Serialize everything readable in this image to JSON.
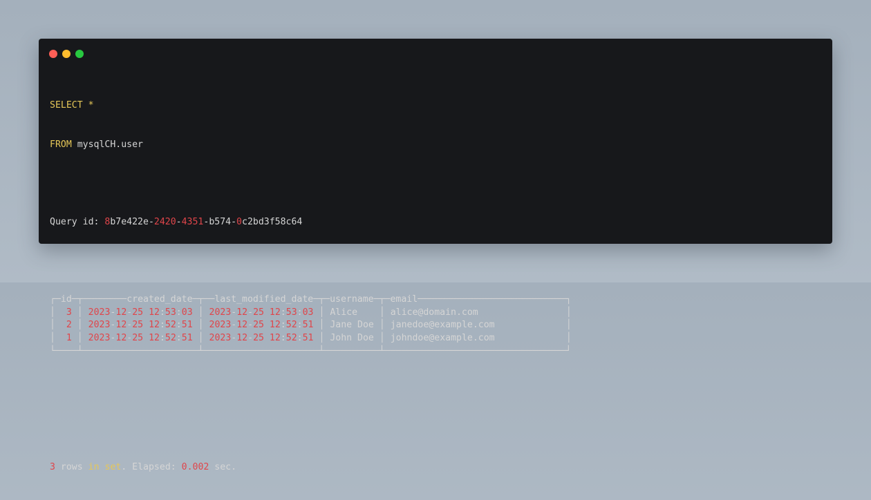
{
  "window": {
    "controls": [
      "close",
      "minimize",
      "maximize"
    ]
  },
  "query": {
    "select_keyword": "SELECT",
    "select_star": "*",
    "from_keyword": "FROM",
    "table": "mysqlCH.user"
  },
  "query_id": {
    "label": "Query id: ",
    "value": "8b7e422e-2420-4351-b574-0c2bd3f58c64"
  },
  "result": {
    "columns": [
      "id",
      "created_date",
      "last_modified_date",
      "username",
      "email"
    ],
    "rows": [
      [
        "3",
        "2023-12-25 12:53:03",
        "2023-12-25 12:53:03",
        "Alice",
        "alice@domain.com"
      ],
      [
        "2",
        "2023-12-25 12:52:51",
        "2023-12-25 12:52:51",
        "Jane Doe",
        "janedoe@example.com"
      ],
      [
        "1",
        "2023-12-25 12:52:51",
        "2023-12-25 12:52:51",
        "John Doe",
        "johndoe@example.com"
      ]
    ]
  },
  "summary": {
    "rows": "3",
    "rows_word": "rows",
    "in_word": "in",
    "set_word": "set",
    "elapsed_label": ". Elapsed: ",
    "elapsed_value": "0.002",
    "unit": "sec."
  },
  "colors": {
    "window_bg": "#17181b",
    "keyword": "#e6c758",
    "number": "#e0454a",
    "text": "#d5d5d5",
    "backdrop": "#a4b0bc"
  }
}
